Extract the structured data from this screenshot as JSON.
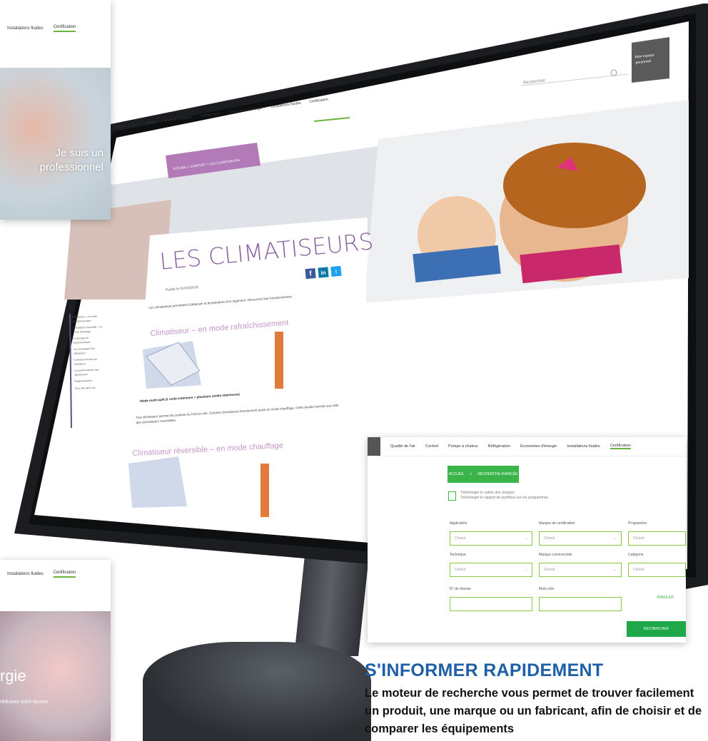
{
  "monitor_screen": {
    "search_placeholder": "Rechercher",
    "login_label": "Mon espace personnel",
    "nav": [
      "Qualité de l'air",
      "Confort",
      "Pompe à chaleur",
      "Réfrigération",
      "Économies d'énergie",
      "Installations fluides",
      "Certification"
    ],
    "nav_active": "Certification",
    "breadcrumb": "ACCUEIL  >  CONFORT  >  LES CLIMATISEURS",
    "article_title": "LES CLIMATISEURS",
    "published": "Publié le 01/03/2018",
    "intro": "Les climatiseurs permettent d'abaisser la température d'un logement. Découvrez leur fonctionnement.",
    "section1_title": "Climatiseur – en mode rafraîchissement",
    "image1_caption": "Mode multi-split (1 unité extérieure + plusieurs unités intérieures)",
    "paragraph2": "Tout climatiseur permet de produire du froid en été. Certains climatiseurs fonctionnent aussi en mode chauffage. Cette double fonction est celle des climatiseurs réversibles.",
    "section2_title": "Climatiseur réversible – en mode chauffage",
    "sidebar_toc": [
      "Climatiseur – en mode rafraîchissement",
      "Climatiseur réversible – en mode chauffage",
      "Le principe de fonctionnement",
      "Les avantages d'un climatiseur",
      "Comment choisir son climatiseur",
      "Les performances des climatiseurs",
      "Réglementation",
      "Pour aller plus loin"
    ],
    "share_icons": [
      "facebook-icon",
      "linkedin-icon",
      "twitter-icon"
    ]
  },
  "panel_top_left": {
    "nav": [
      "Installations fluides",
      "Certification"
    ],
    "caption": "Je suis un professionnel"
  },
  "panel_bottom_left": {
    "nav": [
      "Installations fluides",
      "Certification"
    ],
    "caption": "rgie",
    "subcaption": "réduisez votre facture"
  },
  "search_panel": {
    "nav": [
      "Qualité de l'air",
      "Confort",
      "Pompe à chaleur",
      "Réfrigération",
      "Économies d'énergie",
      "Installations fluides",
      "Certification"
    ],
    "nav_active": "Certification",
    "breadcrumb": [
      "ACCUEIL",
      "RECHERCHE AVANCÉE"
    ],
    "doc_lines": [
      "Télécharger le cahier des charges",
      "Télécharger le rapport de synthèse sur les programmes"
    ],
    "fields": [
      {
        "label": "Application",
        "value": "Choisir"
      },
      {
        "label": "Marque de certification",
        "value": "Choisir"
      },
      {
        "label": "Programme",
        "value": "Choisir"
      },
      {
        "label": "Technique",
        "value": "Choisir"
      },
      {
        "label": "Marque commerciale",
        "value": "Choisir"
      },
      {
        "label": "Catégorie",
        "value": "Choisir"
      },
      {
        "label": "N° de dossier",
        "value": ""
      },
      {
        "label": "Mots-clés",
        "value": ""
      }
    ],
    "reset_label": "ANNULER",
    "search_label": "RECHERCHER"
  },
  "heading": "S'INFORMER RAPIDEMENT",
  "body_text": "Le moteur de recherche vous permet de trouver facilement un produit, une marque ou un fabricant, afin de choisir et de comparer les équipements"
}
